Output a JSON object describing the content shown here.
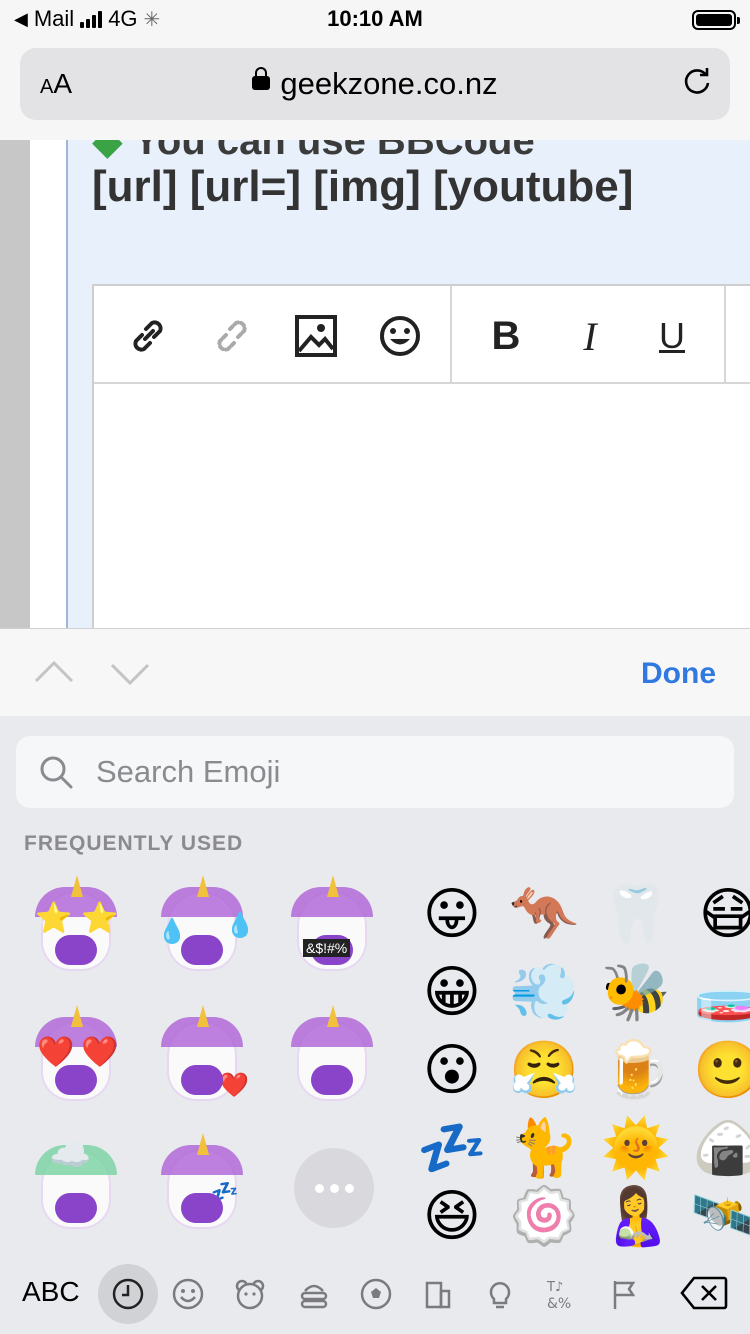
{
  "status_bar": {
    "back_app": "Mail",
    "network": "4G",
    "time": "10:10 AM"
  },
  "browser": {
    "aa_small": "A",
    "aa_large": "A",
    "domain": "geekzone.co.nz"
  },
  "page": {
    "snippet_cut": "You can use BBCode",
    "tags_line": "[url] [url=] [img] [youtube]",
    "toolbar_bold": "B",
    "toolbar_italic": "I",
    "toolbar_underline": "U"
  },
  "accessory": {
    "done_label": "Done"
  },
  "keyboard": {
    "search_placeholder": "Search Emoji",
    "section_label": "FREQUENTLY USED",
    "memoji_stamp": "&$!#%",
    "abc_label": "ABC",
    "emoji_grid": [
      [
        "😛",
        "🦘",
        "🦷",
        "😷"
      ],
      [
        "😀",
        "💨",
        "🐝",
        "🧫"
      ],
      [
        "😮",
        "😤",
        "🍺",
        "🙂"
      ],
      [
        "💤",
        "🐈",
        "🌞",
        "🍙"
      ],
      [
        "😆",
        "🍥",
        "🤱",
        "🛰️"
      ]
    ],
    "categories": [
      "clock-icon",
      "smiley-icon",
      "bear-icon",
      "food-icon",
      "ball-icon",
      "building-icon",
      "bulb-icon",
      "symbols-icon",
      "flag-icon"
    ]
  }
}
